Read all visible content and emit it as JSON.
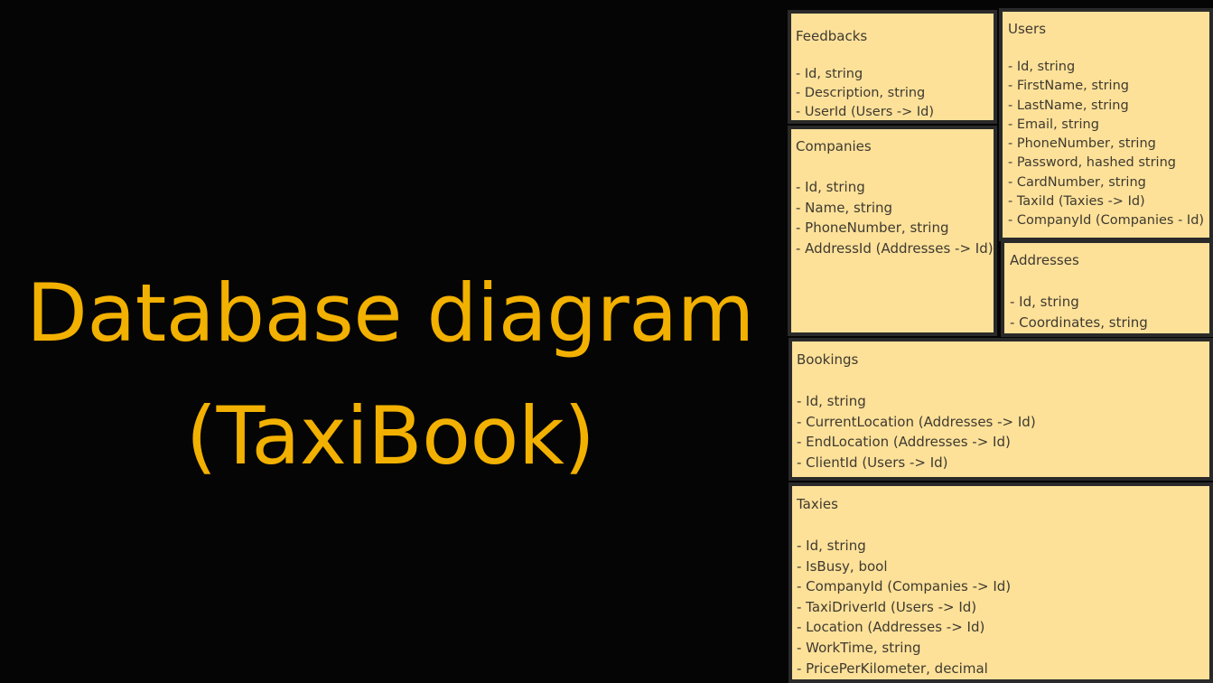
{
  "title": {
    "line1": "Database diagram",
    "line2": "(TaxiBook)"
  },
  "colors": {
    "background": "#050505",
    "title": "#f2b100",
    "card_fill": "#fde199",
    "card_border": "#2a2a2a",
    "card_text": "#3f3a30"
  },
  "tables": {
    "feedbacks": {
      "name": "Feedbacks",
      "fields": [
        "- Id, string",
        "- Description, string",
        "- UserId (Users -> Id)"
      ]
    },
    "companies": {
      "name": "Companies",
      "fields": [
        "- Id, string",
        "- Name, string",
        "- PhoneNumber, string",
        "- AddressId (Addresses -> Id)"
      ]
    },
    "users": {
      "name": "Users",
      "fields": [
        "- Id, string",
        "- FirstName, string",
        "- LastName, string",
        "- Email, string",
        "- PhoneNumber, string",
        "- Password, hashed string",
        "- CardNumber, string",
        "- TaxiId (Taxies -> Id)",
        "- CompanyId (Companies - Id)"
      ]
    },
    "addresses": {
      "name": "Addresses",
      "fields": [
        "- Id, string",
        "- Coordinates, string"
      ]
    },
    "bookings": {
      "name": "Bookings",
      "fields": [
        "- Id, string",
        "- CurrentLocation (Addresses -> Id)",
        "- EndLocation (Addresses -> Id)",
        "- ClientId (Users -> Id)"
      ]
    },
    "taxies": {
      "name": "Taxies",
      "fields": [
        "- Id, string",
        "- IsBusy, bool",
        "- CompanyId (Companies -> Id)",
        "- TaxiDriverId (Users -> Id)",
        "- Location (Addresses -> Id)",
        "- WorkTime, string",
        "- PricePerKilometer, decimal"
      ]
    }
  }
}
